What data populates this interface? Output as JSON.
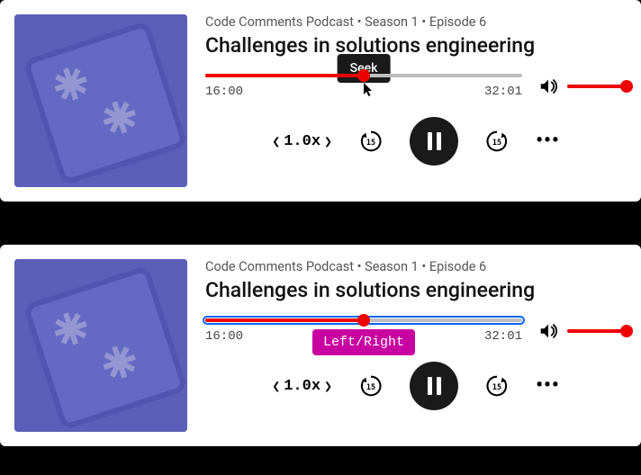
{
  "player1": {
    "meta": "Code Comments Podcast • Season 1 • Episode 6",
    "title": "Challenges in solutions engineering",
    "tooltip": "Seek",
    "elapsed": "16:00",
    "duration": "32:01",
    "progress_pct": 50,
    "speed": "1.0x"
  },
  "player2": {
    "meta": "Code Comments Podcast • Season 1 • Episode 6",
    "title": "Challenges in solutions engineering",
    "tooltip": "Left/Right",
    "elapsed": "16:00",
    "duration": "32:01",
    "progress_pct": 50,
    "speed": "1.0x"
  },
  "colors": {
    "accent": "#ee0000",
    "tooltip_bg": "#1a1a1a",
    "hint_bg": "#c800a1"
  }
}
